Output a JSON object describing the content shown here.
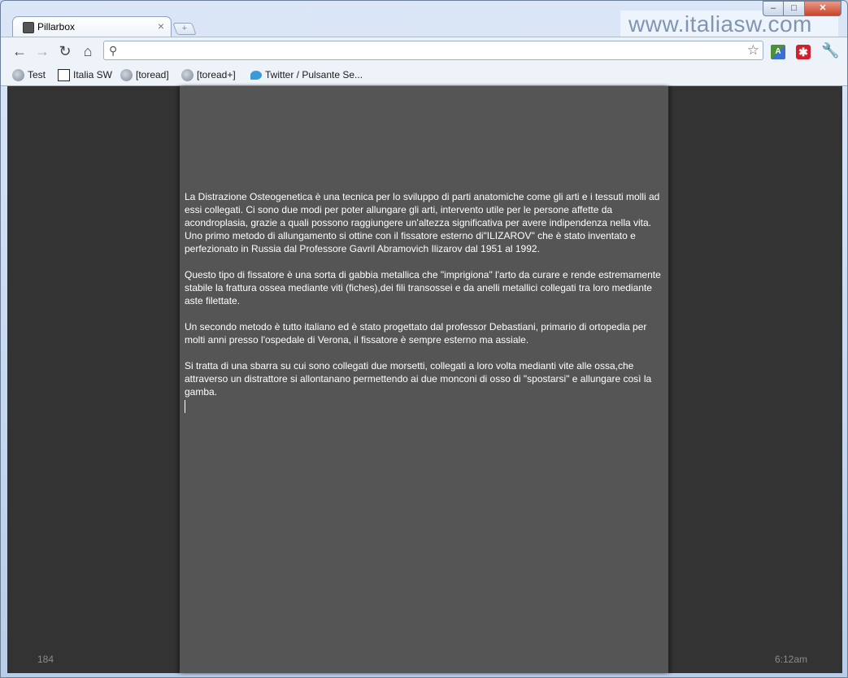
{
  "browser": {
    "tab_title": "Pillarbox",
    "tab_close": "×",
    "new_tab": "+",
    "watermark": "www.italiasw.com",
    "window_controls": {
      "minimize": "–",
      "maximize": "□",
      "close": "✕"
    },
    "nav": {
      "back": "←",
      "forward": "→",
      "reload": "↻",
      "home": "⌂"
    },
    "omnibox_value": "",
    "icons": {
      "search": "search-icon",
      "star": "star-icon",
      "wrench": "wrench-icon"
    },
    "extensions": {
      "translate": "A",
      "red": "✱"
    },
    "bookmarks": [
      {
        "label": "Test",
        "icon": "globe-icon"
      },
      {
        "label": "Italia SW",
        "icon": "italiasw-icon"
      },
      {
        "label": "[toread]",
        "icon": "globe-icon"
      },
      {
        "label": "[toread+]",
        "icon": "globe-icon"
      },
      {
        "label": "Twitter / Pulsante Se...",
        "icon": "twitter-bird-icon"
      }
    ]
  },
  "page": {
    "paragraphs": [
      "La Distrazione Osteogenetica è una tecnica per lo sviluppo di parti anatomiche come gli arti e i tessuti molli ad essi collegati. Ci sono due modi per poter allungare gli arti, intervento utile per le persone affette da acondroplasia, grazie a quali possono raggiungere un'altezza significativa per avere indipendenza nella vita. Uno primo metodo di allungamento si ottine con il fissatore esterno di\"ILIZAROV\" che è stato inventato e perfezionato in Russia dal Professore Gavril Abramovich Ilizarov dal 1951 al 1992.",
      "Questo tipo di fissatore è una sorta di gabbia metallica che \"imprigiona\" l'arto da curare e rende estremamente stabile la frattura ossea mediante viti (fiches),dei fili transossei e da anelli metallici collegati tra loro mediante aste filettate.",
      "Un secondo metodo è tutto italiano ed è stato progettato dal professor Debastiani, primario di ortopedia per molti anni presso l'ospedale di Verona, il fissatore è sempre esterno ma assiale.",
      "Si tratta di una sbarra su cui sono collegati due morsetti, collegati a loro volta medianti vite alle ossa,che attraverso un distrattore si allontanano permettendo ai due monconi di osso di \"spostarsi\" e allungare così la gamba."
    ],
    "word_count": "184",
    "clock": "6:12am",
    "colors": {
      "background": "#333333",
      "pillar": "#555555",
      "text": "#ffffff",
      "status": "#8c8c8c"
    }
  }
}
